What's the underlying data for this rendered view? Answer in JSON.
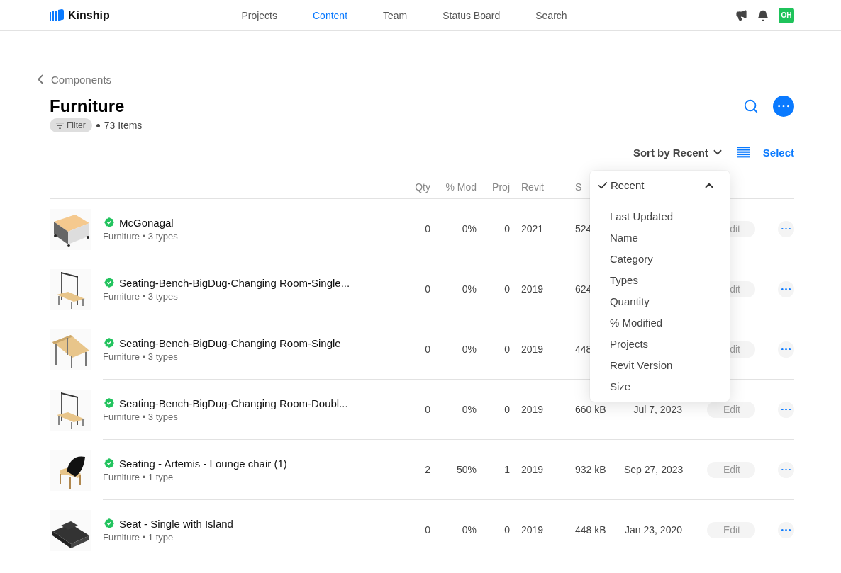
{
  "nav": {
    "brand": "Kinship",
    "links": [
      {
        "label": "Projects",
        "selected": false
      },
      {
        "label": "Content",
        "selected": true
      },
      {
        "label": "Team",
        "selected": false
      },
      {
        "label": "Status Board",
        "selected": false
      },
      {
        "label": "Search",
        "selected": false
      }
    ],
    "avatar": "OH"
  },
  "breadcrumb": "Components",
  "title": "Furniture",
  "filter": "Filter",
  "count": "73 Items",
  "sort": "Sort by Recent",
  "select": "Select",
  "sort_menu": {
    "options": [
      {
        "label": "Recent",
        "selected": true
      },
      {
        "label": "Last Updated",
        "selected": false
      },
      {
        "label": "Name",
        "selected": false
      },
      {
        "label": "Category",
        "selected": false
      },
      {
        "label": "Types",
        "selected": false
      },
      {
        "label": "Quantity",
        "selected": false
      },
      {
        "label": "% Modified",
        "selected": false
      },
      {
        "label": "Projects",
        "selected": false
      },
      {
        "label": "Revit Version",
        "selected": false
      },
      {
        "label": "Size",
        "selected": false
      }
    ]
  },
  "columns": [
    "Qty",
    "% Mod",
    "Proj",
    "Revit",
    "S"
  ],
  "rows": [
    {
      "name": "McGonagal",
      "verified": true,
      "meta": "Furniture • 3 types",
      "qty": "0",
      "mod": "0%",
      "proj": "0",
      "revit": "2021",
      "size": "524",
      "edit": "dit"
    },
    {
      "name": "Seating-Bench-BigDug-Changing Room-Single...",
      "verified": true,
      "meta": "Furniture • 3 types",
      "qty": "0",
      "mod": "0%",
      "proj": "0",
      "revit": "2019",
      "size": "624",
      "edit": "dit"
    },
    {
      "name": "Seating-Bench-BigDug-Changing Room-Single",
      "verified": true,
      "meta": "Furniture • 3 types",
      "qty": "0",
      "mod": "0%",
      "proj": "0",
      "revit": "2019",
      "size": "448",
      "edit": "dit"
    },
    {
      "name": "Seating-Bench-BigDug-Changing Room-Doubl...",
      "verified": true,
      "meta": "Furniture • 3 types",
      "qty": "0",
      "mod": "0%",
      "proj": "0",
      "revit": "2019",
      "size": "660 kB",
      "date": "Jul 7, 2023",
      "edit": "Edit"
    },
    {
      "name": "Seating - Artemis - Lounge chair (1)",
      "verified": true,
      "meta": "Furniture • 1 type",
      "qty": "2",
      "mod": "50%",
      "proj": "1",
      "revit": "2019",
      "size": "932 kB",
      "date": "Sep 27, 2023",
      "edit": "Edit"
    },
    {
      "name": "Seat - Single with Island",
      "verified": true,
      "meta": "Furniture • 1 type",
      "qty": "0",
      "mod": "0%",
      "proj": "0",
      "revit": "2019",
      "size": "448 kB",
      "date": "Jan 23, 2020",
      "edit": "Edit"
    }
  ]
}
